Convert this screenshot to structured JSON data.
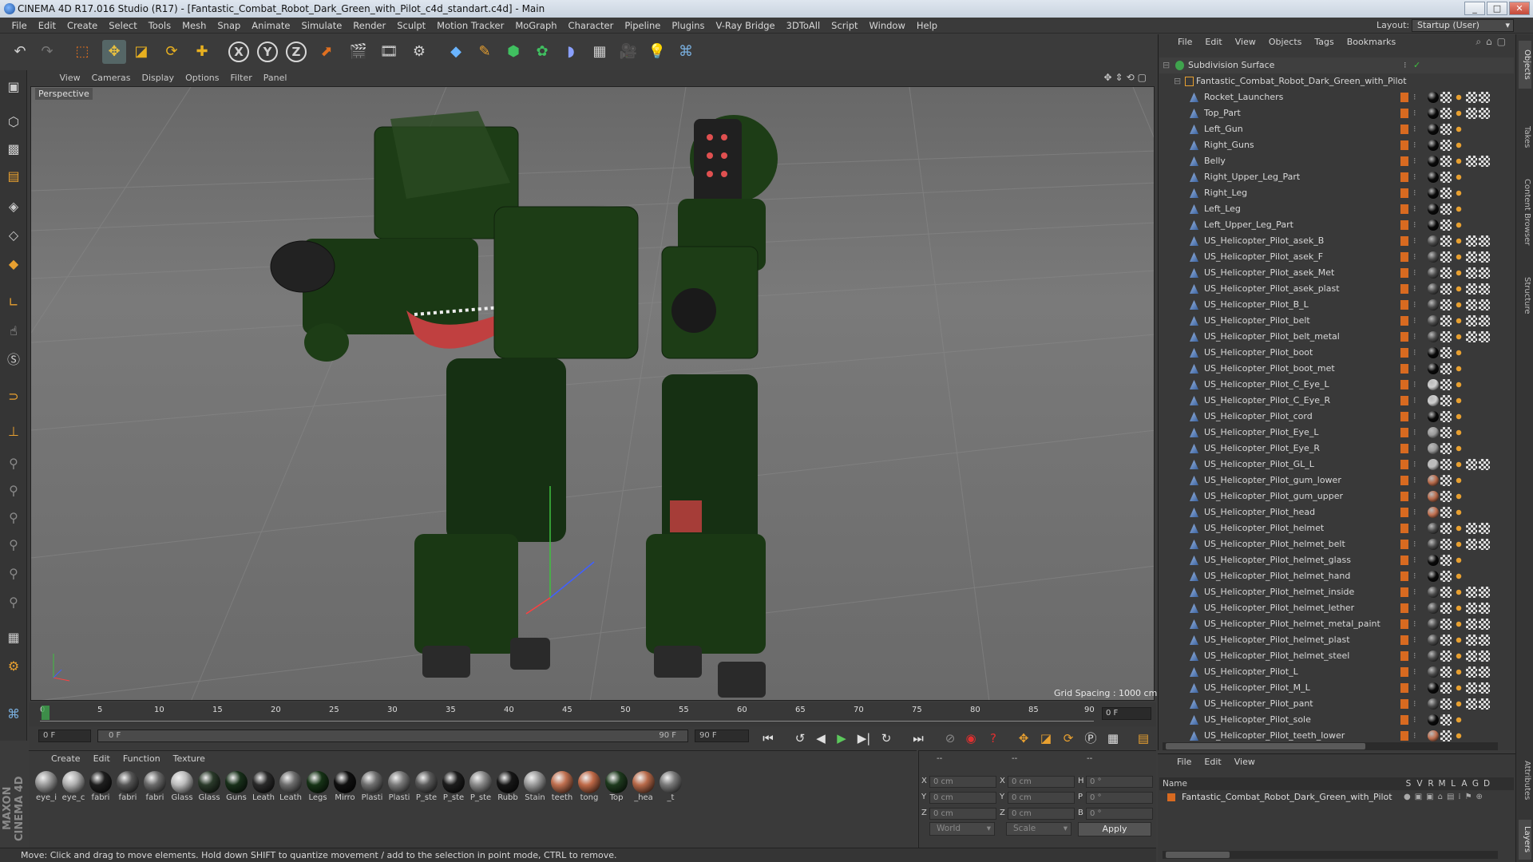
{
  "window": {
    "title": "CINEMA 4D R17.016 Studio (R17) - [Fantastic_Combat_Robot_Dark_Green_with_Pilot_c4d_standart.c4d] - Main",
    "controls": [
      "_",
      "□",
      "✕"
    ]
  },
  "menubar": [
    "File",
    "Edit",
    "Create",
    "Select",
    "Tools",
    "Mesh",
    "Snap",
    "Animate",
    "Simulate",
    "Render",
    "Sculpt",
    "Motion Tracker",
    "MoGraph",
    "Character",
    "Pipeline",
    "Plugins",
    "V-Ray Bridge",
    "3DToAll",
    "Script",
    "Window",
    "Help"
  ],
  "layout": {
    "label": "Layout:",
    "value": "Startup (User)"
  },
  "toolbar_icons": [
    "undo-icon",
    "redo-icon",
    "live-selection-icon",
    "move-icon",
    "scale-icon",
    "rotate-icon",
    "add-icon",
    "x-axis-icon",
    "y-axis-icon",
    "z-axis-icon",
    "coordinate-system-icon",
    "render-view-icon",
    "render-picture-viewer-icon",
    "edit-render-settings-icon",
    "cube-icon",
    "pen-spline-icon",
    "subdivision-icon",
    "array-icon",
    "deformer-icon",
    "floor-icon",
    "camera-icon",
    "light-icon",
    "python-icon"
  ],
  "axis_labels": [
    "X",
    "Y",
    "Z"
  ],
  "viewport": {
    "menu": [
      "View",
      "Cameras",
      "Display",
      "Options",
      "Filter",
      "Panel"
    ],
    "label": "Perspective",
    "grid_spacing": "Grid Spacing : 1000 cm"
  },
  "timeline": {
    "ticks": [
      "0",
      "5",
      "10",
      "15",
      "20",
      "25",
      "30",
      "35",
      "40",
      "45",
      "50",
      "55",
      "60",
      "65",
      "70",
      "75",
      "80",
      "85",
      "90"
    ],
    "current_frame": "0 F",
    "start_field": "0 F",
    "range_start": "0 F",
    "range_end": "90 F",
    "end_field": "90 F"
  },
  "materials": {
    "menu": [
      "Create",
      "Edit",
      "Function",
      "Texture"
    ],
    "items": [
      {
        "label": "eye_i",
        "color": "#9a9a9a"
      },
      {
        "label": "eye_c",
        "color": "#b0b0b0"
      },
      {
        "label": "fabri",
        "color": "#1e1e1e"
      },
      {
        "label": "fabri",
        "color": "#555555"
      },
      {
        "label": "fabri",
        "color": "#6a6a6a"
      },
      {
        "label": "Glass",
        "color": "#bdbdbd"
      },
      {
        "label": "Glass",
        "color": "#2a3a2a"
      },
      {
        "label": "Guns",
        "color": "#18301a"
      },
      {
        "label": "Leath",
        "color": "#2a2a2a"
      },
      {
        "label": "Leath",
        "color": "#6e6e6e"
      },
      {
        "label": "Legs",
        "color": "#163316"
      },
      {
        "label": "Mirro",
        "color": "#101010"
      },
      {
        "label": "Plasti",
        "color": "#707070"
      },
      {
        "label": "Plasti",
        "color": "#7a7a7a"
      },
      {
        "label": "P_ste",
        "color": "#5a5a5a"
      },
      {
        "label": "P_ste",
        "color": "#1c1c1c"
      },
      {
        "label": "P_ste",
        "color": "#8a8a8a"
      },
      {
        "label": "Rubb",
        "color": "#161616"
      },
      {
        "label": "Stain",
        "color": "#9a9a9a"
      },
      {
        "label": "teeth",
        "color": "#c07050"
      },
      {
        "label": "tong",
        "color": "#c06a48"
      },
      {
        "label": "Top",
        "color": "#1e3a1e"
      },
      {
        "label": "_hea",
        "color": "#b86a4a"
      },
      {
        "label": "_t",
        "color": "#7a7a7a"
      }
    ]
  },
  "coordinates": {
    "header": [
      "--",
      "--",
      "--"
    ],
    "rows": [
      {
        "a": "X",
        "av": "0 cm",
        "b": "X",
        "bv": "0 cm",
        "c": "H",
        "cv": "0 °"
      },
      {
        "a": "Y",
        "av": "0 cm",
        "b": "Y",
        "bv": "0 cm",
        "c": "P",
        "cv": "0 °"
      },
      {
        "a": "Z",
        "av": "0 cm",
        "b": "Z",
        "bv": "0 cm",
        "c": "B",
        "cv": "0 °"
      }
    ],
    "space": "World",
    "mode": "Scale",
    "apply": "Apply"
  },
  "status": "Move: Click and drag to move elements. Hold down SHIFT to quantize movement / add to the selection in point mode, CTRL to remove.",
  "object_manager": {
    "menu": [
      "File",
      "Edit",
      "View",
      "Objects",
      "Tags",
      "Bookmarks"
    ],
    "root": "Subdivision Surface",
    "group": "Fantastic_Combat_Robot_Dark_Green_with_Pilot",
    "objects": [
      {
        "name": "Rocket_Launchers",
        "tags": [
          "#0a0a0a",
          "check",
          "dot",
          "chk",
          "chk"
        ]
      },
      {
        "name": "Top_Part",
        "tags": [
          "#0a0a0a",
          "check",
          "dot",
          "chk",
          "chk"
        ]
      },
      {
        "name": "Left_Gun",
        "tags": [
          "#0a0a0a",
          "check",
          "dot"
        ]
      },
      {
        "name": "Right_Guns",
        "tags": [
          "#0a0a0a",
          "check",
          "dot"
        ]
      },
      {
        "name": "Belly",
        "tags": [
          "#0a0a0a",
          "check",
          "dot",
          "chk",
          "chk"
        ]
      },
      {
        "name": "Right_Upper_Leg_Part",
        "tags": [
          "#0a0a0a",
          "check",
          "dot"
        ]
      },
      {
        "name": "Right_Leg",
        "tags": [
          "#0a0a0a",
          "check",
          "dot"
        ]
      },
      {
        "name": "Left_Leg",
        "tags": [
          "#0a0a0a",
          "check",
          "dot"
        ]
      },
      {
        "name": "Left_Upper_Leg_Part",
        "tags": [
          "#0a0a0a",
          "check",
          "dot"
        ]
      },
      {
        "name": "US_Helicopter_Pilot_asek_B",
        "tags": [
          "#4a4a4a",
          "check",
          "dot",
          "chk",
          "chk"
        ]
      },
      {
        "name": "US_Helicopter_Pilot_asek_F",
        "tags": [
          "#4a4a4a",
          "check",
          "dot",
          "chk",
          "chk"
        ]
      },
      {
        "name": "US_Helicopter_Pilot_asek_Met",
        "tags": [
          "#4a4a4a",
          "check",
          "dot",
          "chk",
          "chk"
        ]
      },
      {
        "name": "US_Helicopter_Pilot_asek_plast",
        "tags": [
          "#4a4a4a",
          "check",
          "dot",
          "chk",
          "chk"
        ]
      },
      {
        "name": "US_Helicopter_Pilot_B_L",
        "tags": [
          "#4a4a4a",
          "check",
          "dot",
          "chk",
          "chk"
        ]
      },
      {
        "name": "US_Helicopter_Pilot_belt",
        "tags": [
          "#4a4a4a",
          "check",
          "dot",
          "chk",
          "chk"
        ]
      },
      {
        "name": "US_Helicopter_Pilot_belt_metal",
        "tags": [
          "#4a4a4a",
          "check",
          "dot",
          "chk",
          "chk"
        ]
      },
      {
        "name": "US_Helicopter_Pilot_boot",
        "tags": [
          "#0a0a0a",
          "check",
          "dot"
        ]
      },
      {
        "name": "US_Helicopter_Pilot_boot_met",
        "tags": [
          "#0a0a0a",
          "check",
          "dot"
        ]
      },
      {
        "name": "US_Helicopter_Pilot_C_Eye_L",
        "tags": [
          "#cfcfcf",
          "check",
          "dot"
        ]
      },
      {
        "name": "US_Helicopter_Pilot_C_Eye_R",
        "tags": [
          "#cfcfcf",
          "check",
          "dot"
        ]
      },
      {
        "name": "US_Helicopter_Pilot_cord",
        "tags": [
          "#0a0a0a",
          "check",
          "dot"
        ]
      },
      {
        "name": "US_Helicopter_Pilot_Eye_L",
        "tags": [
          "#9a9a9a",
          "check",
          "dot"
        ]
      },
      {
        "name": "US_Helicopter_Pilot_Eye_R",
        "tags": [
          "#9a9a9a",
          "check",
          "dot"
        ]
      },
      {
        "name": "US_Helicopter_Pilot_GL_L",
        "tags": [
          "#bdbdbd",
          "check",
          "dot",
          "chk",
          "chk"
        ]
      },
      {
        "name": "US_Helicopter_Pilot_gum_lower",
        "tags": [
          "#b86a4a",
          "check",
          "dot"
        ]
      },
      {
        "name": "US_Helicopter_Pilot_gum_upper",
        "tags": [
          "#b86a4a",
          "check",
          "dot"
        ]
      },
      {
        "name": "US_Helicopter_Pilot_head",
        "tags": [
          "#c07050",
          "check",
          "dot"
        ]
      },
      {
        "name": "US_Helicopter_Pilot_helmet",
        "tags": [
          "#4a4a4a",
          "check",
          "dot",
          "chk",
          "chk"
        ]
      },
      {
        "name": "US_Helicopter_Pilot_helmet_belt",
        "tags": [
          "#4a4a4a",
          "check",
          "dot",
          "chk",
          "chk"
        ]
      },
      {
        "name": "US_Helicopter_Pilot_helmet_glass",
        "tags": [
          "#0a0a0a",
          "check",
          "dot"
        ]
      },
      {
        "name": "US_Helicopter_Pilot_helmet_hand",
        "tags": [
          "#0a0a0a",
          "check",
          "dot"
        ]
      },
      {
        "name": "US_Helicopter_Pilot_helmet_inside",
        "tags": [
          "#4a4a4a",
          "check",
          "dot",
          "chk",
          "chk"
        ]
      },
      {
        "name": "US_Helicopter_Pilot_helmet_lether",
        "tags": [
          "#4a4a4a",
          "check",
          "dot",
          "chk",
          "chk"
        ]
      },
      {
        "name": "US_Helicopter_Pilot_helmet_metal_paint",
        "tags": [
          "#4a4a4a",
          "check",
          "dot",
          "chk",
          "chk"
        ]
      },
      {
        "name": "US_Helicopter_Pilot_helmet_plast",
        "tags": [
          "#4a4a4a",
          "check",
          "dot",
          "chk",
          "chk"
        ]
      },
      {
        "name": "US_Helicopter_Pilot_helmet_steel",
        "tags": [
          "#4a4a4a",
          "check",
          "dot",
          "chk",
          "chk"
        ]
      },
      {
        "name": "US_Helicopter_Pilot_L",
        "tags": [
          "#4a4a4a",
          "check",
          "dot",
          "chk",
          "chk"
        ]
      },
      {
        "name": "US_Helicopter_Pilot_M_L",
        "tags": [
          "#0a0a0a",
          "check",
          "dot",
          "chk",
          "chk"
        ]
      },
      {
        "name": "US_Helicopter_Pilot_pant",
        "tags": [
          "#4a4a4a",
          "check",
          "dot",
          "chk",
          "chk"
        ]
      },
      {
        "name": "US_Helicopter_Pilot_sole",
        "tags": [
          "#0a0a0a",
          "check",
          "dot"
        ]
      },
      {
        "name": "US_Helicopter_Pilot_teeth_lower",
        "tags": [
          "#c07050",
          "check",
          "dot"
        ]
      }
    ]
  },
  "layers": {
    "menu": [
      "File",
      "Edit",
      "View"
    ],
    "header_name": "Name",
    "columns": [
      "S",
      "V",
      "R",
      "M",
      "L",
      "A",
      "G",
      "D"
    ],
    "row": "Fantastic_Combat_Robot_Dark_Green_with_Pilot"
  },
  "right_tabs": [
    "Objects",
    "Takes",
    "Content Browser",
    "Structure",
    "Attributes",
    "Layers"
  ],
  "brand": "MAXON CINEMA 4D",
  "colors": {
    "robot_green": "#1d3d16",
    "accent_orange": "#e07020",
    "selection_orange": "#d86a20"
  }
}
